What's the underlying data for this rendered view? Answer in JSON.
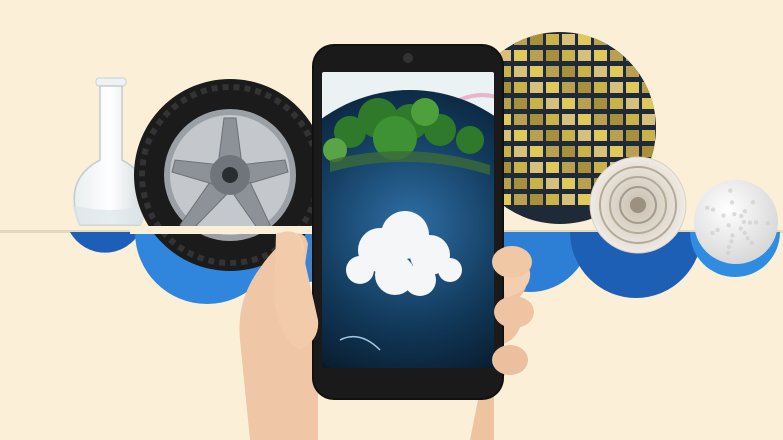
{
  "scene": {
    "background_color": "#fbf0d7",
    "accent_blue": "#1f6fd0",
    "light_blue": "#3d95e8",
    "objects": [
      "glass-flask",
      "car-tire",
      "smartphone",
      "solar-wafer",
      "fabric-roll",
      "golf-ball",
      "hand"
    ],
    "phone_screen": "earth-globe-with-trees-and-cloud"
  }
}
